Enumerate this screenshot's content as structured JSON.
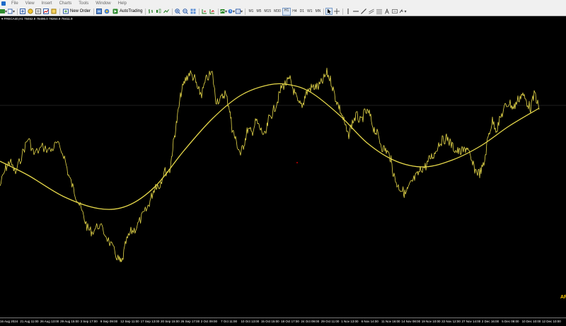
{
  "menu": {
    "items": [
      "File",
      "View",
      "Insert",
      "Charts",
      "Tools",
      "Window",
      "Help"
    ]
  },
  "toolbar": {
    "new_order_label": "New Order",
    "autotrading_label": "AutoTrading",
    "timeframes": [
      "M1",
      "M5",
      "M15",
      "M30",
      "H1",
      "H4",
      "D1",
      "W1",
      "MN"
    ],
    "active_timeframe": "H1"
  },
  "chart": {
    "header": "▾ FRECA40,H1  78462.9 78496.0 78264.9 78411.9",
    "side_label": "AR",
    "colors": {
      "price": "#e6d84a",
      "ma": "#e6d84a",
      "background": "#000000",
      "reference_line": "#404040",
      "marker": "#ff0000"
    },
    "time_labels": [
      "16 Aug 2024",
      "21 Aug 11:00",
      "26 Aug 13:00",
      "29 Aug 15:00",
      "3 Sep 17:00",
      "9 Sep 09:00",
      "12 Sep 11:00",
      "17 Sep 13:00",
      "20 Sep 15:00",
      "26 Sep 17:00",
      "2 Oct 09:00",
      "7 Oct 11:00",
      "10 Oct 13:00",
      "15 Oct 15:00",
      "18 Oct 17:00",
      "24 Oct 09:00",
      "29 Oct 11:00",
      "1 Nov 13:00",
      "6 Nov 14:00",
      "11 Nov 16:00",
      "14 Nov 08:00",
      "19 Nov 10:00",
      "22 Nov 12:00",
      "27 Nov 14:00",
      "2 Dec 16:00",
      "5 Dec 08:00",
      "10 Dec 10:00",
      "12 Dec 10:00"
    ]
  }
}
